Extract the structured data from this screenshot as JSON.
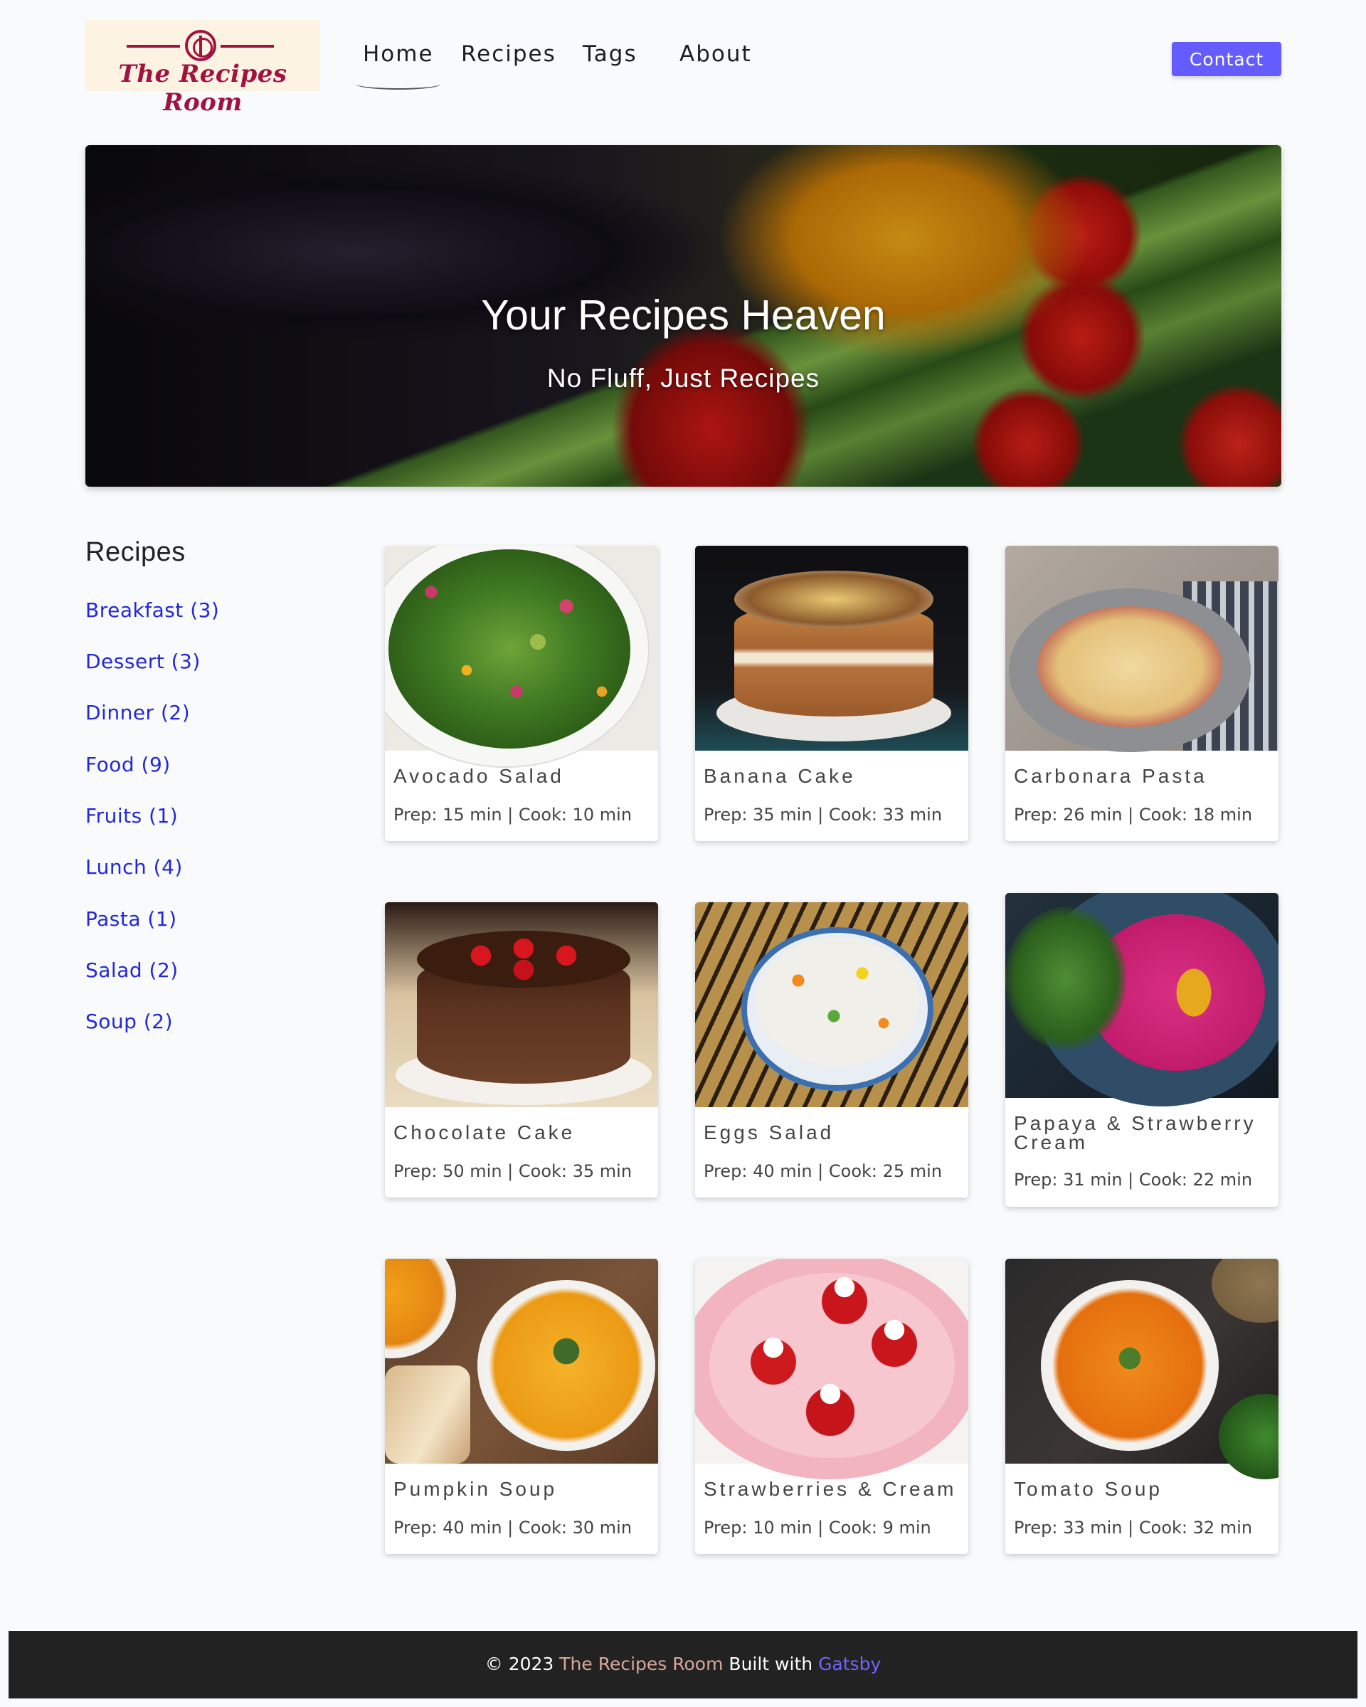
{
  "header": {
    "logo_text": "The Recipes Room",
    "nav": [
      {
        "label": "Home",
        "active": true
      },
      {
        "label": "Recipes",
        "active": false
      },
      {
        "label": "Tags",
        "active": false
      },
      {
        "label": "About",
        "active": false
      }
    ],
    "contact_label": "Contact",
    "accent_color": "#645cff"
  },
  "hero": {
    "title": "Your Recipes Heaven",
    "subtitle": "No Fluff, Just Recipes"
  },
  "sidebar": {
    "title": "Recipes",
    "tags": [
      "Breakfast (3)",
      "Dessert (3)",
      "Dinner (2)",
      "Food (9)",
      "Fruits (1)",
      "Lunch (4)",
      "Pasta (1)",
      "Salad (2)",
      "Soup (2)"
    ],
    "link_color": "#2427d6"
  },
  "recipes": [
    {
      "title": "Avocado Salad",
      "meta": "Prep: 15 min | Cook: 10 min"
    },
    {
      "title": "Banana Cake",
      "meta": "Prep: 35 min | Cook: 33 min"
    },
    {
      "title": "Carbonara Pasta",
      "meta": "Prep: 26 min | Cook: 18 min"
    },
    {
      "title": "Chocolate Cake",
      "meta": "Prep: 50 min | Cook: 35 min"
    },
    {
      "title": "Eggs Salad",
      "meta": "Prep: 40 min | Cook: 25 min"
    },
    {
      "title": "Papaya & Strawberry Cream",
      "meta": "Prep: 31 min | Cook: 22 min"
    },
    {
      "title": "Pumpkin Soup",
      "meta": "Prep: 40 min | Cook: 30 min"
    },
    {
      "title": "Strawberries & Cream",
      "meta": "Prep: 10 min | Cook: 9 min"
    },
    {
      "title": "Tomato Soup",
      "meta": "Prep: 33 min | Cook: 32 min"
    }
  ],
  "footer": {
    "copyright": "© 2023",
    "brand": "The Recipes Room",
    "built_with": "Built with",
    "gatsby": "Gatsby"
  }
}
